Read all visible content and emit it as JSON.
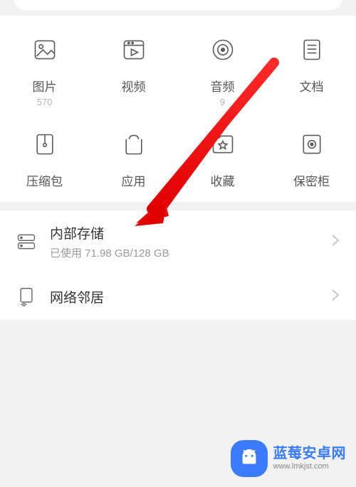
{
  "categories": [
    {
      "key": "images",
      "label": "图片",
      "sub": "570",
      "icon": "image-icon"
    },
    {
      "key": "videos",
      "label": "视频",
      "sub": "",
      "icon": "video-icon"
    },
    {
      "key": "audio",
      "label": "音频",
      "sub": "9",
      "icon": "audio-icon"
    },
    {
      "key": "docs",
      "label": "文档",
      "sub": "",
      "icon": "document-icon"
    },
    {
      "key": "archives",
      "label": "压缩包",
      "sub": "",
      "icon": "archive-icon"
    },
    {
      "key": "apps",
      "label": "应用",
      "sub": "",
      "icon": "app-icon"
    },
    {
      "key": "favorites",
      "label": "收藏",
      "sub": "",
      "icon": "favorite-icon"
    },
    {
      "key": "safe",
      "label": "保密柜",
      "sub": "",
      "icon": "safe-icon"
    }
  ],
  "storage": {
    "title": "内部存储",
    "subtitle": "已使用 71.98 GB/128 GB"
  },
  "network": {
    "title": "网络邻居"
  },
  "watermark": {
    "title": "蓝莓安卓网",
    "url": "www.lmkjst.com"
  }
}
